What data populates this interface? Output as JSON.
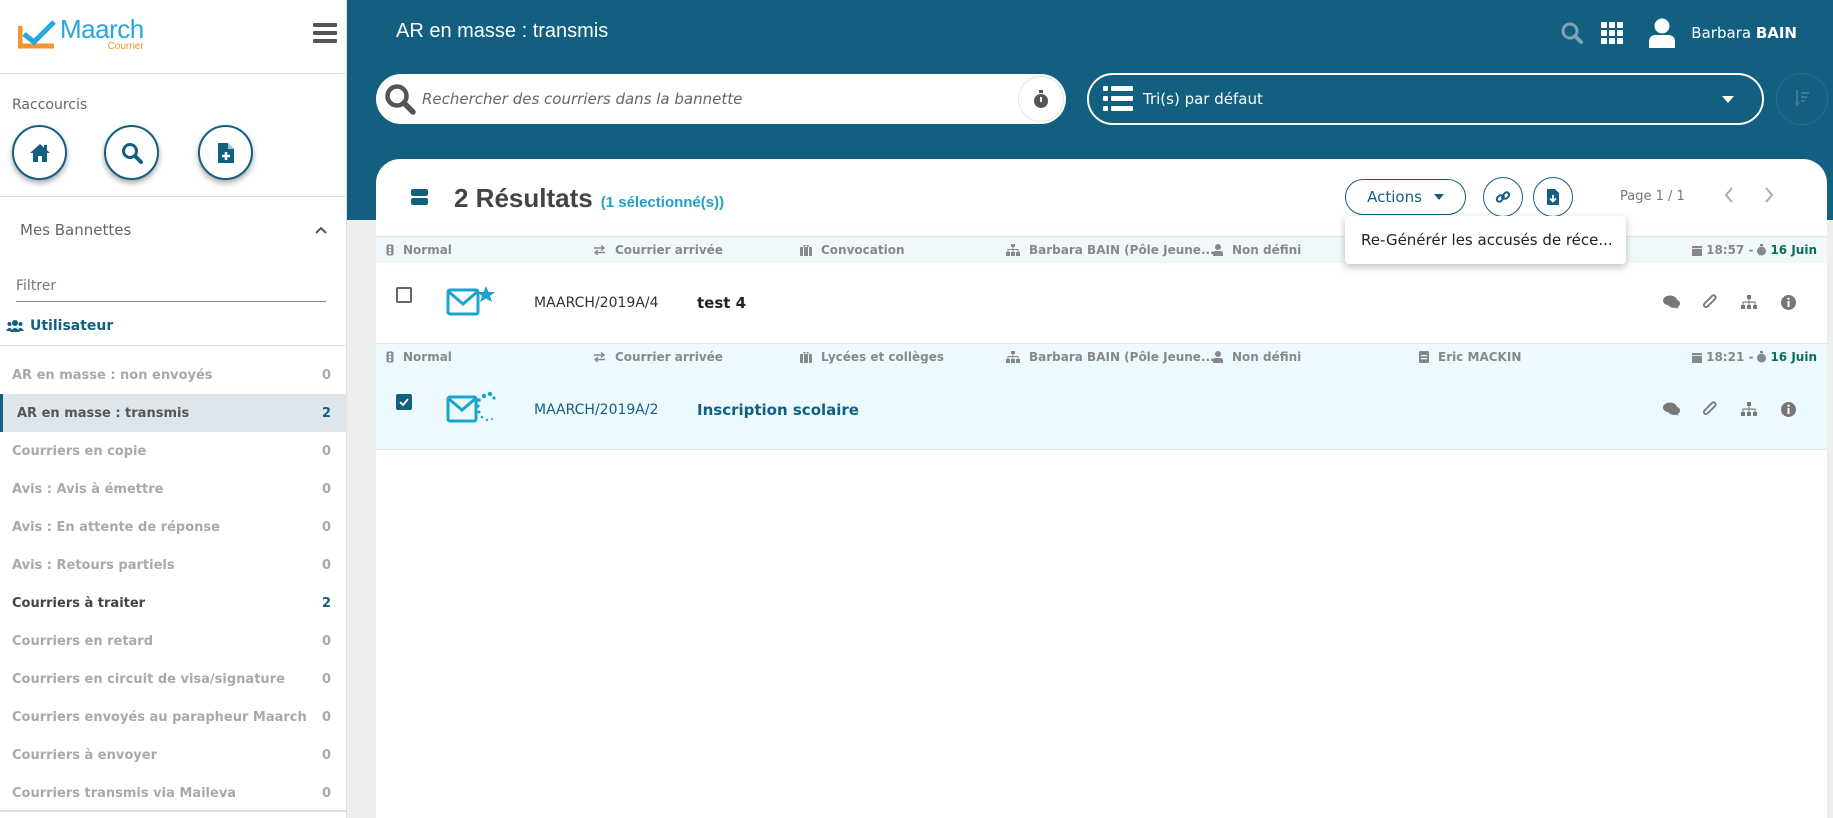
{
  "app": {
    "logo_main": "Maarch",
    "logo_sub": "Courrier",
    "menu_icon": "hamburger-icon"
  },
  "sidebar": {
    "shortcuts_title": "Raccourcis",
    "shortcuts": [
      {
        "name": "home",
        "icon": "home-icon"
      },
      {
        "name": "search",
        "icon": "search-icon"
      },
      {
        "name": "new-document",
        "icon": "file-plus-icon"
      }
    ],
    "bannettes_title": "Mes Bannettes",
    "filter_placeholder": "Filtrer",
    "group_title": "Utilisateur",
    "baskets": [
      {
        "label": "AR en masse : non envoyés",
        "count": "0"
      },
      {
        "label": "AR en masse : transmis",
        "count": "2",
        "active": true
      },
      {
        "label": "Courriers en copie",
        "count": "0"
      },
      {
        "label": "Avis : Avis à émettre",
        "count": "0"
      },
      {
        "label": "Avis : En attente de réponse",
        "count": "0"
      },
      {
        "label": "Avis : Retours partiels",
        "count": "0"
      },
      {
        "label": "Courriers à traiter",
        "count": "2",
        "bold": true
      },
      {
        "label": "Courriers en retard",
        "count": "0"
      },
      {
        "label": "Courriers en circuit de visa/signature",
        "count": "0"
      },
      {
        "label": "Courriers envoyés au parapheur Maarch",
        "count": "0"
      },
      {
        "label": "Courriers à envoyer",
        "count": "0"
      },
      {
        "label": "Courriers transmis via Maileva",
        "count": "0"
      }
    ]
  },
  "header": {
    "title": "AR en masse : transmis",
    "user_first": "Barbara",
    "user_last": "BAIN",
    "search_placeholder": "Rechercher des courriers dans la bannette",
    "sort_label": "Tri(s) par défaut"
  },
  "results": {
    "count_label": "2 Résultats",
    "selected_label": "(1 sélectionné(s))",
    "actions_label": "Actions",
    "page_label": "Page 1 / 1",
    "menu_item": "Re-Générér les accusés de réce..."
  },
  "rows": [
    {
      "priority": "Normal",
      "category": "Courrier arrivée",
      "doctype": "Convocation",
      "entity": "Barbara BAIN (Pôle Jeune...",
      "assignee": "Non défini",
      "contact": "",
      "time": "18:57 -",
      "date": "16 Juin",
      "reference": "MAARCH/2019A/4",
      "subject": "test 4",
      "selected": false,
      "status_icon": "mail-new-icon"
    },
    {
      "priority": "Normal",
      "category": "Courrier arrivée",
      "doctype": "Lycées et collèges",
      "entity": "Barbara BAIN (Pôle Jeune...",
      "assignee": "Non défini",
      "contact": "Eric MACKIN",
      "time": "18:21 -",
      "date": "16 Juin",
      "reference": "MAARCH/2019A/2",
      "subject": "Inscription scolaire",
      "selected": true,
      "status_icon": "mail-processing-icon"
    }
  ],
  "colors": {
    "primary": "#135f7f",
    "accent": "#24a0c4",
    "date_green": "#0d6e57",
    "logo_blue": "#24a8dd",
    "logo_orange": "#f39432"
  }
}
